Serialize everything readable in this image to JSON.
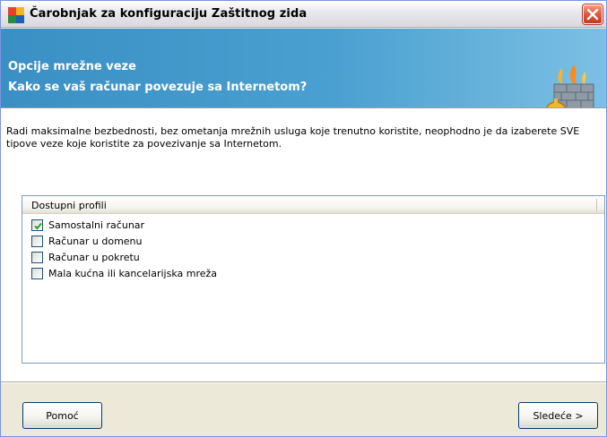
{
  "window": {
    "title": "Čarobnjak za konfiguraciju Zaštitnog zida",
    "title_icon": "avg-logo-icon",
    "close_icon": "close-icon"
  },
  "banner": {
    "line1": "Opcije mrežne veze",
    "line2": "Kako se vaš računar povezuje sa Internetom?",
    "art_icon": "firewall-gear-icon",
    "color": "#3a8fc4"
  },
  "content": {
    "description": "Radi maksimalne bezbednosti, bez ometanja mrežnih usluga koje trenutno koristite, neophodno je da izaberete SVE tipove veze koje koristite za povezivanje sa Internetom."
  },
  "profiles": {
    "header": "Dostupni profili",
    "items": [
      {
        "label": "Samostalni računar",
        "checked": true
      },
      {
        "label": "Računar u domenu",
        "checked": false
      },
      {
        "label": "Računar u pokretu",
        "checked": false
      },
      {
        "label": "Mala kućna ili kancelarijska mreža",
        "checked": false
      }
    ]
  },
  "buttons": {
    "help": "Pomoć",
    "next": "Sledeće >"
  }
}
